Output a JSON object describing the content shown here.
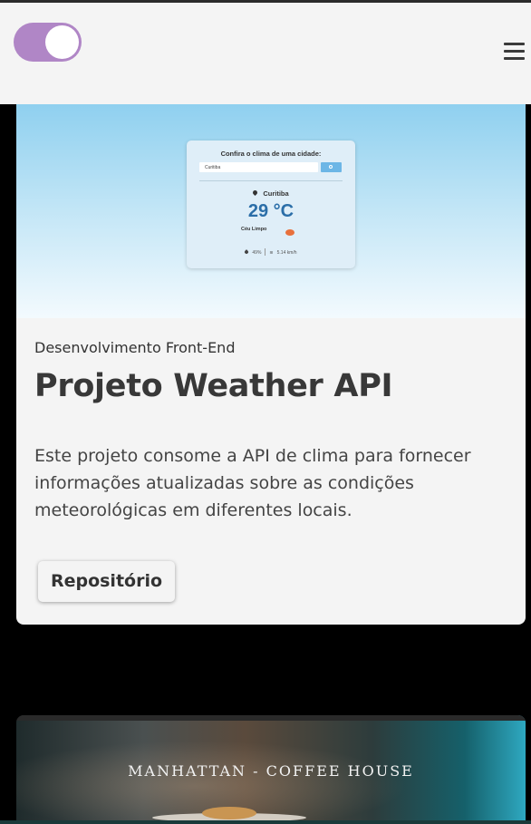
{
  "header": {
    "menu_icon": "hamburger-icon",
    "theme_toggle": {
      "state": "on",
      "color": "#b086c6"
    }
  },
  "project_card": {
    "preview": {
      "prompt": "Confira o clima de uma cidade:",
      "input_value": "Curitiba",
      "city": "Curitiba",
      "temperature": "29 °C",
      "condition": "Céu Limpo",
      "humidity": "49%",
      "wind": "5.14 km/h"
    },
    "category": "Desenvolvimento Front-End",
    "title": "Projeto Weather API",
    "description": "Este projeto consome a API de clima para fornecer informações atualizadas sobre as condições meteorológicas em diferentes locais.",
    "button_label": "Repositório"
  },
  "next_card": {
    "brand_text": "MANHATTAN - COFFEE HOUSE"
  },
  "colors": {
    "header_bg": "#f4f4f4",
    "card_bg": "#f4f4f4",
    "page_bg": "#000000",
    "temperature": "#2b6ea8"
  }
}
